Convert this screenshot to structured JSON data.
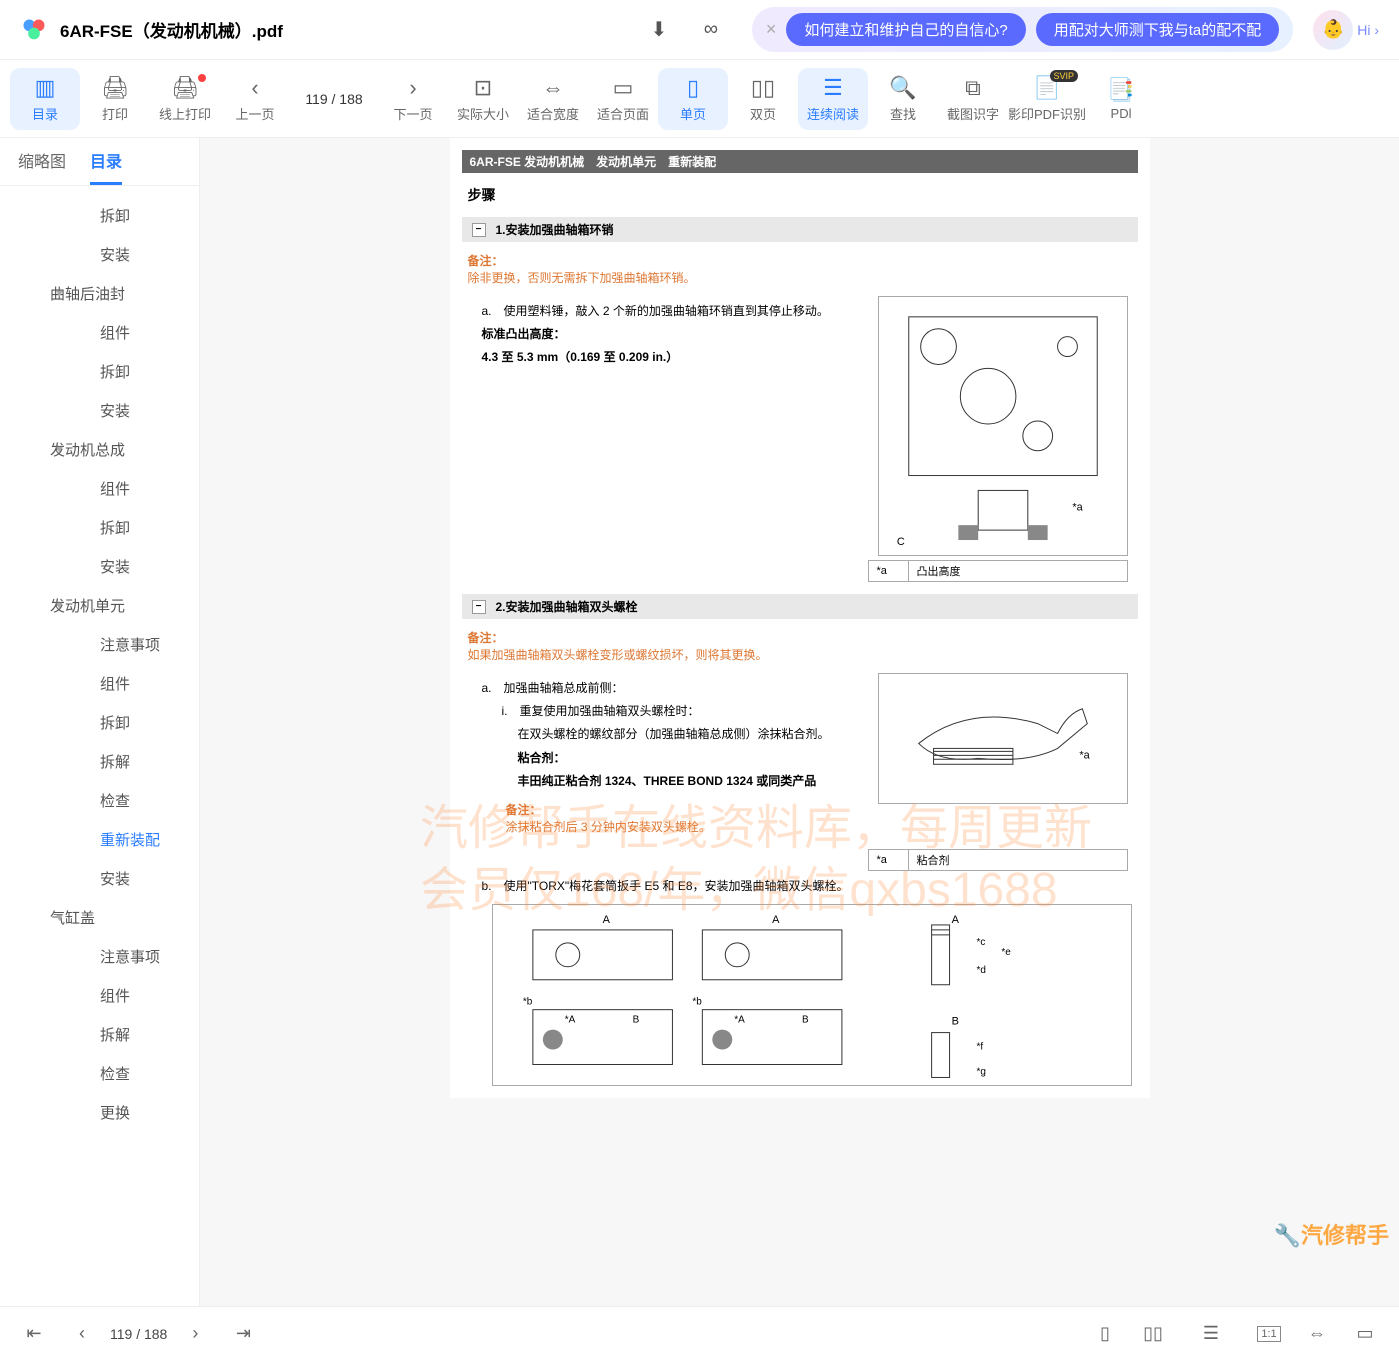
{
  "header": {
    "filename": "6AR-FSE（发动机机械）.pdf",
    "hi": "Hi ›"
  },
  "pills": {
    "p1": "如何建立和维护自己的自信心?",
    "p2": "用配对大师测下我与ta的配不配"
  },
  "toolbar": {
    "toc": "目录",
    "print": "打印",
    "onlineprint": "线上打印",
    "prev": "上一页",
    "pageinfo": "119 / 188",
    "next": "下一页",
    "actual": "实际大小",
    "fitw": "适合宽度",
    "fitp": "适合页面",
    "single": "单页",
    "double": "双页",
    "cont": "连续阅读",
    "find": "查找",
    "ocr": "截图识字",
    "pdfocr": "影印PDF识别",
    "pdl": "PDl"
  },
  "sidetabs": {
    "thumb": "缩略图",
    "toc": "目录"
  },
  "tree": {
    "i1": "拆卸",
    "i2": "安装",
    "g1": "曲轴后油封",
    "i3": "组件",
    "i4": "拆卸",
    "i5": "安装",
    "g2": "发动机总成",
    "i6": "组件",
    "i7": "拆卸",
    "i8": "安装",
    "g3": "发动机单元",
    "i9": "注意事项",
    "i10": "组件",
    "i11": "拆卸",
    "i12": "拆解",
    "i13": "检查",
    "i14": "重新装配",
    "i15": "安装",
    "g4": "气缸盖",
    "i16": "注意事项",
    "i17": "组件",
    "i18": "拆解",
    "i19": "检查",
    "i20": "更换"
  },
  "doc": {
    "hdr": "6AR-FSE 发动机机械　发动机单元　重新装配",
    "steps": "步骤",
    "s1": "1.安装加强曲轴箱环销",
    "note1_lbl": "备注：",
    "note1": "除非更换，否则无需拆下加强曲轴箱环销。",
    "a1": "a.　使用塑料锤，敲入 2 个新的加强曲轴箱环销直到其停止移动。",
    "a1b": "标准凸出高度：",
    "a1c": "4.3 至 5.3 mm（0.169 至 0.209 in.）",
    "t1a": "*a",
    "t1b": "凸出高度",
    "s2": "2.安装加强曲轴箱双头螺栓",
    "note2_lbl": "备注：",
    "note2": "如果加强曲轴箱双头螺栓变形或螺纹损坏，则将其更换。",
    "a2": "a.　加强曲轴箱总成前侧：",
    "a2i": "i.　重复使用加强曲轴箱双头螺栓时：",
    "a2ii": "在双头螺栓的螺纹部分（加强曲轴箱总成侧）涂抹粘合剂。",
    "a2iii": "粘合剂：",
    "a2iv": "丰田纯正粘合剂 1324、THREE BOND 1324 或同类产品",
    "note3_lbl": "备注：",
    "note3": "涂抹粘合剂后 3 分钟内安装双头螺栓。",
    "t2a": "*a",
    "t2b": "粘合剂",
    "b1": "b.　使用\"TORX\"梅花套筒扳手 E5 和 E8，安装加强曲轴箱双头螺栓。"
  },
  "watermark": {
    "l1": "汽修帮手在线资料库，每周更新",
    "l2": "会员仅168/年，微信qxbs1688"
  },
  "footer": {
    "pg": "119 / 188"
  },
  "brand": "🔧汽修帮手"
}
